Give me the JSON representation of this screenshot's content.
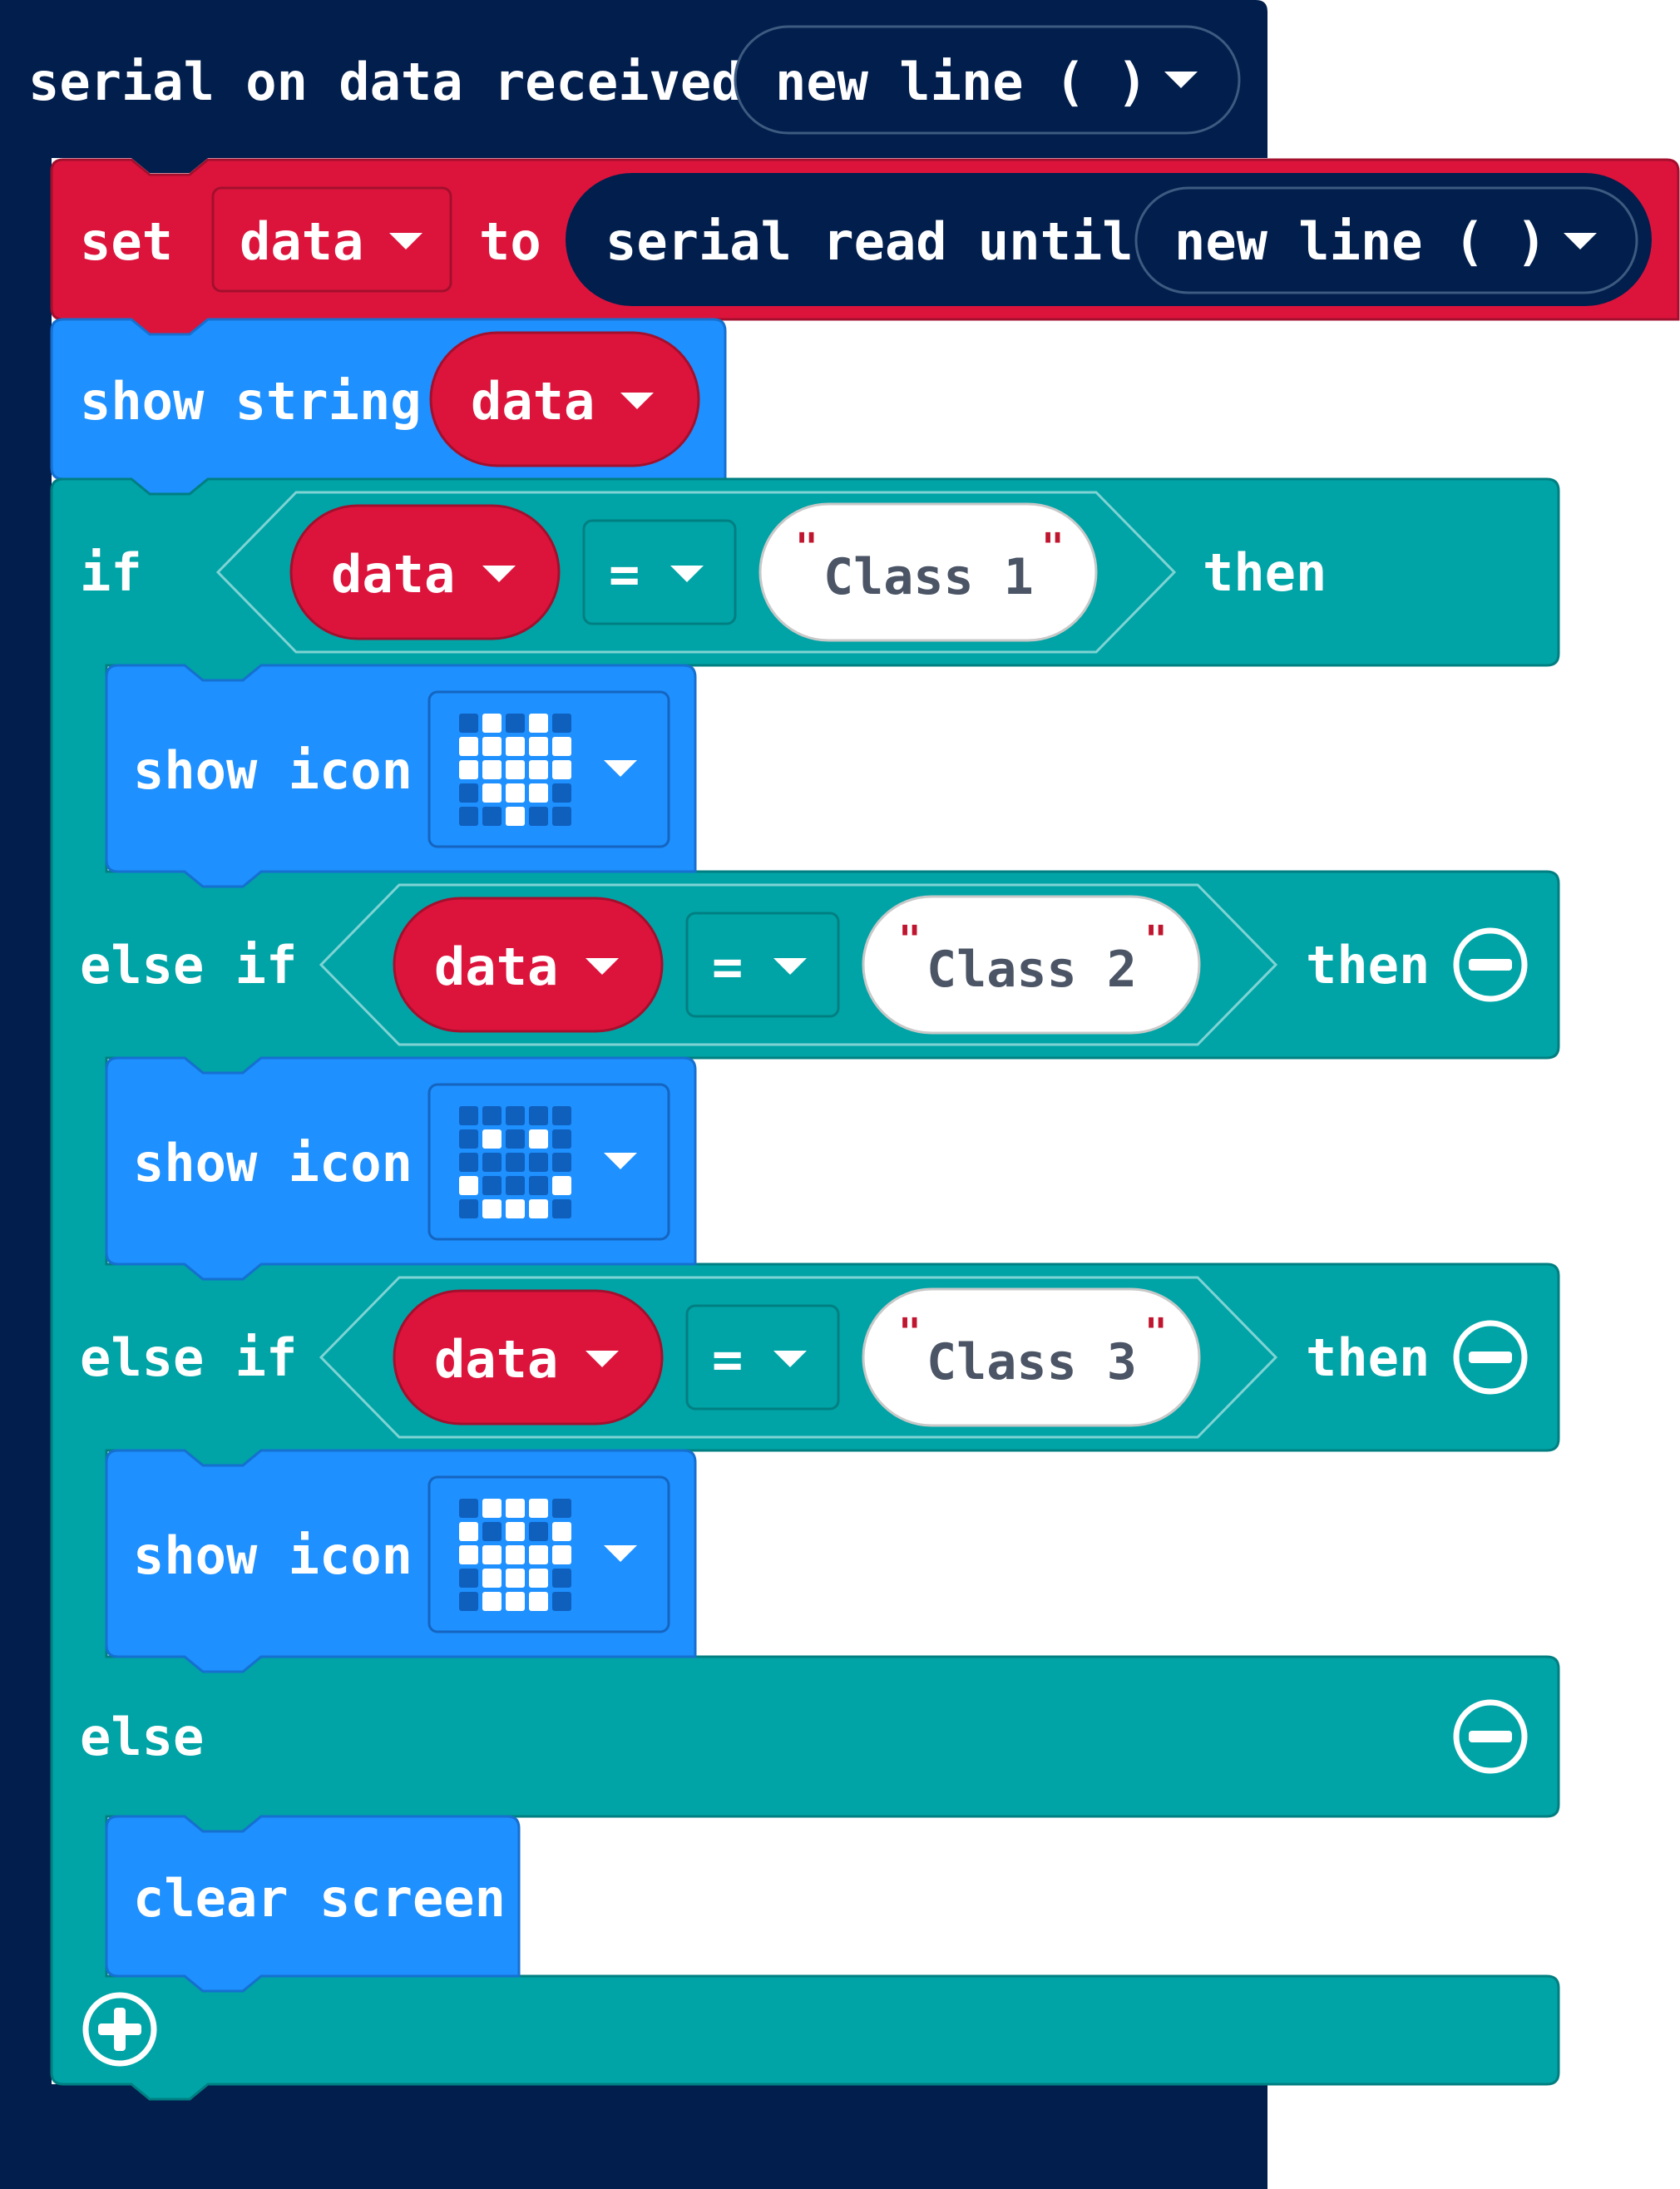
{
  "colors": {
    "serial": "#011e4d",
    "variables": "#dc143c",
    "basic": "#1e90ff",
    "logic": "#00a4a6",
    "led_on": "#ffffff",
    "led_off": "#0f5fbd"
  },
  "event": {
    "label": "serial on data received",
    "delimiter": "new line ( )"
  },
  "set_block": {
    "set_label": "set",
    "variable": "data",
    "to_label": "to",
    "reader_label": "serial read until",
    "delimiter": "new line ( )"
  },
  "show_string": {
    "label": "show string",
    "variable": "data"
  },
  "if_block": {
    "if_label": "if",
    "then_label": "then",
    "else_if_label": "else if",
    "else_label": "else",
    "branches": [
      {
        "variable": "data",
        "operator": "=",
        "value": "Class 1",
        "action": "show icon",
        "icon_name": "heart-icon",
        "icon": [
          [
            0,
            1,
            0,
            1,
            0
          ],
          [
            1,
            1,
            1,
            1,
            1
          ],
          [
            1,
            1,
            1,
            1,
            1
          ],
          [
            0,
            1,
            1,
            1,
            0
          ],
          [
            0,
            0,
            1,
            0,
            0
          ]
        ]
      },
      {
        "variable": "data",
        "operator": "=",
        "value": "Class 2",
        "action": "show icon",
        "icon_name": "happy-face-icon",
        "icon": [
          [
            0,
            0,
            0,
            0,
            0
          ],
          [
            0,
            1,
            0,
            1,
            0
          ],
          [
            0,
            0,
            0,
            0,
            0
          ],
          [
            1,
            0,
            0,
            0,
            1
          ],
          [
            0,
            1,
            1,
            1,
            0
          ]
        ]
      },
      {
        "variable": "data",
        "operator": "=",
        "value": "Class 3",
        "action": "show icon",
        "icon_name": "skull-icon",
        "icon": [
          [
            0,
            1,
            1,
            1,
            0
          ],
          [
            1,
            0,
            1,
            0,
            1
          ],
          [
            1,
            1,
            1,
            1,
            1
          ],
          [
            0,
            1,
            1,
            1,
            0
          ],
          [
            0,
            1,
            1,
            1,
            0
          ]
        ]
      }
    ],
    "else_action": "clear screen"
  }
}
